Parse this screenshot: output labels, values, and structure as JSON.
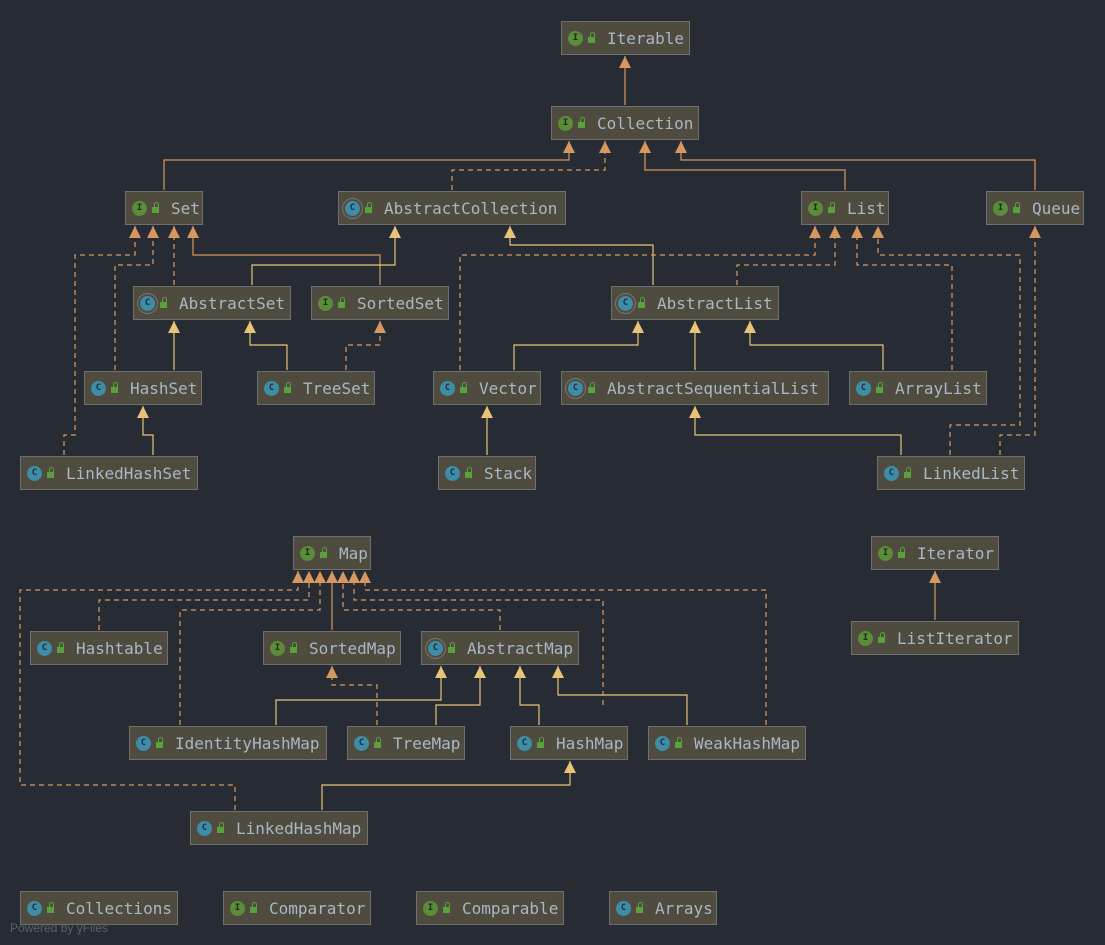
{
  "diagram_title": "Java Collections class hierarchy",
  "powered_by": "Powered by yFiles",
  "nodes": [
    {
      "name": "Iterable",
      "kind": "I"
    },
    {
      "name": "Collection",
      "kind": "I"
    },
    {
      "name": "Set",
      "kind": "I"
    },
    {
      "name": "AbstractCollection",
      "kind": "A"
    },
    {
      "name": "List",
      "kind": "I"
    },
    {
      "name": "Queue",
      "kind": "I"
    },
    {
      "name": "AbstractSet",
      "kind": "A"
    },
    {
      "name": "SortedSet",
      "kind": "I"
    },
    {
      "name": "AbstractList",
      "kind": "A"
    },
    {
      "name": "HashSet",
      "kind": "C"
    },
    {
      "name": "TreeSet",
      "kind": "C"
    },
    {
      "name": "Vector",
      "kind": "C"
    },
    {
      "name": "AbstractSequentialList",
      "kind": "A"
    },
    {
      "name": "ArrayList",
      "kind": "C"
    },
    {
      "name": "LinkedHashSet",
      "kind": "C"
    },
    {
      "name": "Stack",
      "kind": "C"
    },
    {
      "name": "LinkedList",
      "kind": "C"
    },
    {
      "name": "Map",
      "kind": "I"
    },
    {
      "name": "Iterator",
      "kind": "I"
    },
    {
      "name": "Hashtable",
      "kind": "C"
    },
    {
      "name": "SortedMap",
      "kind": "I"
    },
    {
      "name": "AbstractMap",
      "kind": "A"
    },
    {
      "name": "ListIterator",
      "kind": "I"
    },
    {
      "name": "IdentityHashMap",
      "kind": "C"
    },
    {
      "name": "TreeMap",
      "kind": "C"
    },
    {
      "name": "HashMap",
      "kind": "C"
    },
    {
      "name": "WeakHashMap",
      "kind": "C"
    },
    {
      "name": "LinkedHashMap",
      "kind": "C"
    },
    {
      "name": "Collections",
      "kind": "C"
    },
    {
      "name": "Comparator",
      "kind": "I"
    },
    {
      "name": "Comparable",
      "kind": "I"
    },
    {
      "name": "Arrays",
      "kind": "C"
    }
  ],
  "icon_letters": {
    "I": "I",
    "C": "C",
    "A": "C"
  },
  "colors": {
    "background": "#272b33",
    "extends_class": "#e8c378",
    "extends_interface": "#d6985f",
    "implements": "#d89a5e",
    "node_fill": "#4f4b3e",
    "text": "#a9b7c6"
  }
}
